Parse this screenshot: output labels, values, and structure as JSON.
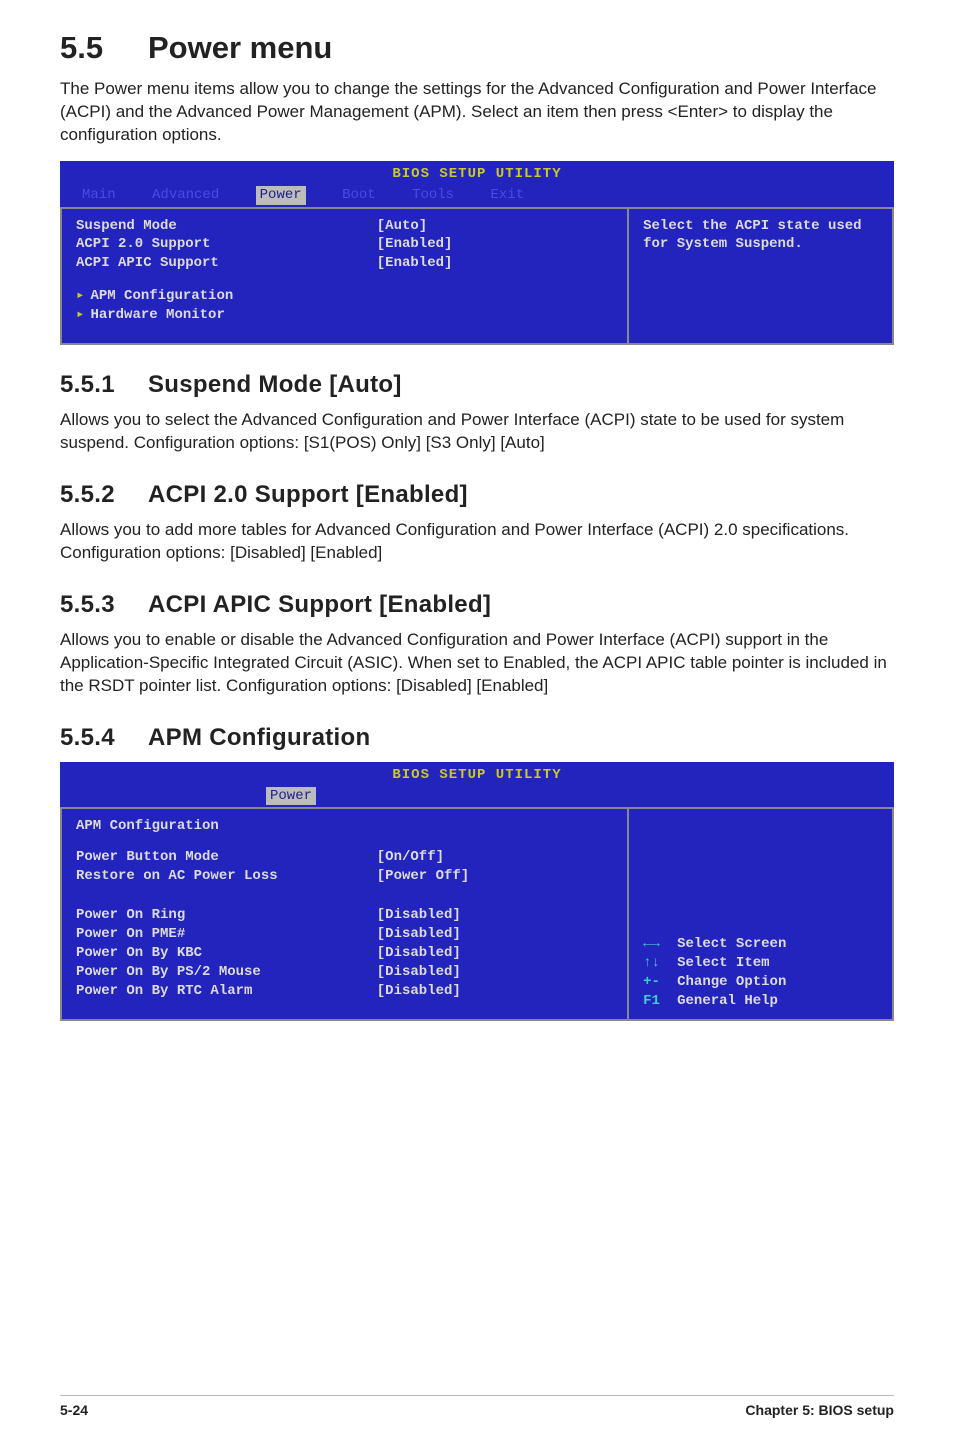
{
  "title": {
    "num": "5.5",
    "text": "Power menu"
  },
  "intro": "The Power menu items allow you to change the settings for the Advanced Configuration and Power Interface (ACPI) and the Advanced Power Management (APM). Select an item then press <Enter> to display the configuration options.",
  "bios1": {
    "header": "BIOS SETUP UTILITY",
    "tabs": [
      "Main",
      "Advanced",
      "Power",
      "Boot",
      "Tools",
      "Exit"
    ],
    "active_tab": "Power",
    "rows": [
      {
        "label": "Suspend Mode",
        "value": "[Auto]"
      },
      {
        "label": "ACPI 2.0 Support",
        "value": "[Enabled]"
      },
      {
        "label": "ACPI APIC Support",
        "value": "[Enabled]"
      }
    ],
    "submenus": [
      "APM Configuration",
      "Hardware Monitor"
    ],
    "help": "Select the ACPI state used for System Suspend."
  },
  "sections": [
    {
      "num": "5.5.1",
      "title": "Suspend Mode [Auto]",
      "body": "Allows you to select the Advanced Configuration and Power Interface (ACPI) state to be used for system suspend. Configuration options: [S1(POS) Only] [S3 Only] [Auto]"
    },
    {
      "num": "5.5.2",
      "title": "ACPI 2.0 Support [Enabled]",
      "body": "Allows you to add more tables for Advanced Configuration and Power Interface (ACPI) 2.0 specifications. Configuration options: [Disabled] [Enabled]"
    },
    {
      "num": "5.5.3",
      "title": "ACPI APIC Support [Enabled]",
      "body": "Allows you to enable or disable the Advanced Configuration and Power Interface (ACPI) support in the Application-Specific Integrated Circuit (ASIC). When set to Enabled, the ACPI APIC table pointer is included in the RSDT pointer list. Configuration options: [Disabled] [Enabled]"
    },
    {
      "num": "5.5.4",
      "title": "APM Configuration",
      "body": ""
    }
  ],
  "bios2": {
    "header": "BIOS SETUP UTILITY",
    "active_tab": "Power",
    "heading": "APM Configuration",
    "rows_a": [
      {
        "label": "Power Button Mode",
        "value": "[On/Off]"
      },
      {
        "label": "Restore on AC Power Loss",
        "value": "[Power Off]"
      }
    ],
    "rows_b": [
      {
        "label": "Power On Ring",
        "value": "[Disabled]"
      },
      {
        "label": "Power On PME#",
        "value": "[Disabled]"
      },
      {
        "label": "Power On By KBC",
        "value": "[Disabled]"
      },
      {
        "label": "Power On By PS/2 Mouse",
        "value": "[Disabled]"
      },
      {
        "label": "Power On By RTC Alarm",
        "value": "[Disabled]"
      }
    ],
    "nav": [
      {
        "key": "←→",
        "label": "Select Screen"
      },
      {
        "key": "↑↓",
        "label": "Select Item"
      },
      {
        "key": "+-",
        "label": "Change Option"
      },
      {
        "key": "F1",
        "label": "General Help"
      }
    ]
  },
  "footer": {
    "left": "5-24",
    "right": "Chapter 5: BIOS setup"
  }
}
